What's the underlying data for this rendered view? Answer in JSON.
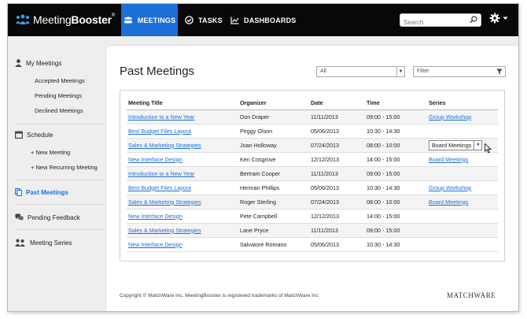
{
  "brand": {
    "name_light": "Meeting",
    "name_bold": "Booster",
    "tm": "®"
  },
  "nav": {
    "meetings": "MEETINGS",
    "tasks": "TASKS",
    "dashboards": "DASHBOARDS"
  },
  "search": {
    "placeholder": "Search"
  },
  "colors": {
    "accent": "#1b6fd6",
    "topbar": "#080808"
  },
  "sidebar": {
    "my_meetings": "My Meetings",
    "accepted": "Accepted Meetings",
    "pending": "Pending Meetings",
    "declined": "Declined Meetings",
    "schedule": "Schedule",
    "new_meeting": "+ New Meeting",
    "new_recurring": "+ New Recurring Meeting",
    "past_meetings": "Past Meetings",
    "pending_feedback": "Pending Feedback",
    "meeting_series": "Meeting Series"
  },
  "main": {
    "title": "Past Meetings",
    "all_select": "All",
    "filter_placeholder": "Filter",
    "columns": [
      "Meeting Title",
      "Organizer",
      "Date",
      "Time",
      "Series"
    ],
    "rows": [
      {
        "title": "Introduction to a New Year",
        "organizer": "Don Draper",
        "date": "11/11/2013",
        "time": "09:00 - 15:00",
        "series": "Group Workshop"
      },
      {
        "title": "Best Budget Files Layout",
        "organizer": "Peggy Olson",
        "date": "05/06/2013",
        "time": "10:30 - 14:30",
        "series": ""
      },
      {
        "title": "Sales & Marketing Strategies",
        "organizer": "Joan Holloway",
        "date": "07/24/2013",
        "time": "08:00 - 10:00",
        "series": "Board Meetings",
        "series_dropdown": true
      },
      {
        "title": "New Interface Design",
        "organizer": "Ken Cosgrove",
        "date": "12/12/2013",
        "time": "14:00 - 15:00",
        "series": "Board Meetings"
      },
      {
        "title": "Introduction to a New Year",
        "organizer": "Bertram Cooper",
        "date": "11/11/2013",
        "time": "09:00 - 15:00",
        "series": ""
      },
      {
        "title": "Best Budget Files Layout",
        "organizer": "Herman Phillips",
        "date": "05/06/2013",
        "time": "10:30 - 14:30",
        "series": "Group Workshop"
      },
      {
        "title": "Sales & Marketing Strategies",
        "organizer": "Roger Sterling",
        "date": "07/24/2013",
        "time": "08:00 - 10:00",
        "series": "Board Meetings"
      },
      {
        "title": "New Interface Design",
        "organizer": "Pete Campbell",
        "date": "12/12/2013",
        "time": "14:00 - 15:00",
        "series": ""
      },
      {
        "title": "Sales & Marketing Strategies",
        "organizer": "Lane Pryce",
        "date": "11/11/2013",
        "time": "09:00 - 15:00",
        "series": ""
      },
      {
        "title": "New Interface Design",
        "organizer": "Salvatore Romano",
        "date": "05/06/2013",
        "time": "10:30 - 14:30",
        "series": ""
      }
    ]
  },
  "footer": {
    "copyright": "Copyright © MatchWare Inc. MeetingBooster is registered trademarks of MatchWare Inc",
    "logo": "MATCHWARE"
  }
}
